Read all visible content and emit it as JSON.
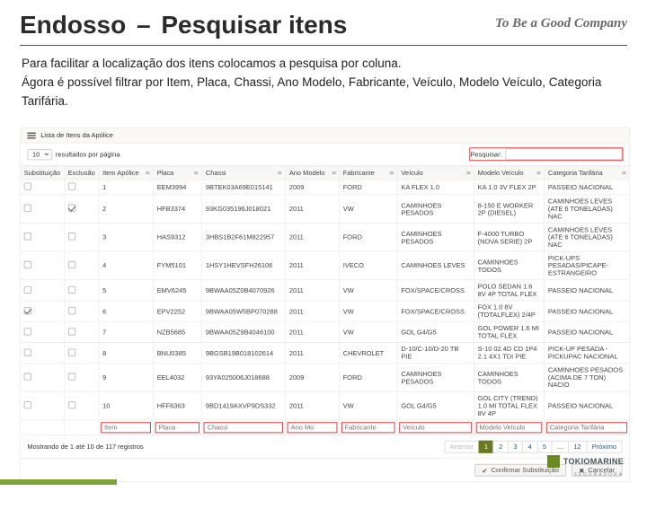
{
  "header": {
    "title_a": "Endosso",
    "dash": "–",
    "title_b": "Pesquisar itens",
    "tagline": "To Be a Good Company"
  },
  "description": {
    "line1": "Para facilitar a localização dos itens colocamos a pesquisa por coluna.",
    "line2": "Ágora é possível filtrar por Item, Placa, Chassi, Ano Modelo, Fabricante, Veículo, Modelo Veículo, Categoria Tarifária."
  },
  "panel": {
    "title": "Lista de Itens da Apólice",
    "per_page_value": "10",
    "per_page_label": "resultados por página",
    "search_label": "Pesquisar:",
    "search_placeholder": ""
  },
  "columns": [
    "Substituição",
    "Exclusão",
    "Item Apólice",
    "Placa",
    "Chassi",
    "Ano Modelo",
    "Fabricante",
    "Veículo",
    "Modelo Veículo",
    "Categoria Tarifária"
  ],
  "rows": [
    {
      "sub": false,
      "exc": false,
      "item": "1",
      "placa": "EEM3994",
      "chassi": "9BTEK03A69E015141",
      "ano": "2009",
      "fab": "FORD",
      "vei": "KA FLEX 1.0",
      "mod": "KA 1.0 3V FLEX 2P",
      "cat": "PASSEIO NACIONAL"
    },
    {
      "sub": false,
      "exc": true,
      "item": "2",
      "placa": "HFB3374",
      "chassi": "93KG035196J018021",
      "ano": "2011",
      "fab": "VW",
      "vei": "CAMINHOES PESADOS",
      "mod": "8-150 E WORKER 2P (DIESEL)",
      "cat": "CAMINHOES LEVES (ATE 6 TONELADAS) NAC"
    },
    {
      "sub": false,
      "exc": false,
      "item": "3",
      "placa": "HAS9312",
      "chassi": "3HBS1B2F61M822957",
      "ano": "2011",
      "fab": "FORD",
      "vei": "CAMINHOES PESADOS",
      "mod": "F-4000 TURBO (NOVA SERIE) 2P",
      "cat": "CAMINHOES LEVES (ATE 6 TONELADAS) NAC"
    },
    {
      "sub": false,
      "exc": false,
      "item": "4",
      "placa": "FYM5101",
      "chassi": "1HSY1HEVSFH26106",
      "ano": "2011",
      "fab": "IVECO",
      "vei": "CAMINHOES LEVES",
      "mod": "CAMINHOES TODOS",
      "cat": "PICK-UPS PESADAS/PICAPE-ESTRANGEIRO"
    },
    {
      "sub": false,
      "exc": false,
      "item": "5",
      "placa": "EMV6245",
      "chassi": "9BWAA05Z0B4070926",
      "ano": "2011",
      "fab": "VW",
      "vei": "FOX/SPACE/CROSS",
      "mod": "POLO SEDAN 1.6 8V 4P TOTAL FLEX",
      "cat": "PASSEIO NACIONAL"
    },
    {
      "sub": true,
      "exc": false,
      "item": "6",
      "placa": "EPV2252",
      "chassi": "9BWAA05W5BP070288",
      "ano": "2011",
      "fab": "VW",
      "vei": "FOX/SPACE/CROSS",
      "mod": "FOX 1.0 8V (TOTALFLEX) 2/4P",
      "cat": "PASSEIO NACIONAL"
    },
    {
      "sub": false,
      "exc": false,
      "item": "7",
      "placa": "NZB5685",
      "chassi": "9BWAA05Z9B4046100",
      "ano": "2011",
      "fab": "VW",
      "vei": "GOL G4/G5",
      "mod": "GOL POWER 1.6 MI TOTAL FLEX",
      "cat": "PASSEIO NACIONAL"
    },
    {
      "sub": false,
      "exc": false,
      "item": "8",
      "placa": "BNU0385",
      "chassi": "9BGSB19B018102614",
      "ano": "2011",
      "fab": "CHEVROLET",
      "vei": "D-10/C-10/D-20 TB PIE",
      "mod": "S-10 02.4D CD 1P4 2.1 4X1 TDI PIE",
      "cat": "PICK-UP PESADA - PICKUPAC NACIONAL"
    },
    {
      "sub": false,
      "exc": false,
      "item": "9",
      "placa": "EEL4032",
      "chassi": "93YA025006J018688",
      "ano": "2009",
      "fab": "FORD",
      "vei": "CAMINHOES PESADOS",
      "mod": "CAMINHOES TODOS",
      "cat": "CAMINHOES PESADOS (ACIMA DE 7 TON) NACIO"
    },
    {
      "sub": false,
      "exc": false,
      "item": "10",
      "placa": "HFF6363",
      "chassi": "9BD1419AXVP9DS332",
      "ano": "2011",
      "fab": "VW",
      "vei": "GOL G4/G5",
      "mod": "GOL CITY (TREND) 1.0 MI TOTAL FLEX 8V 4P",
      "cat": "PASSEIO NACIONAL"
    }
  ],
  "filter_placeholders": [
    "Item",
    "Placa",
    "Chassi",
    "Ano Mo",
    "Fabricante",
    "Veículo",
    "Modelo Veículo",
    "Categoria Tarifária"
  ],
  "footer": {
    "info": "Mostrando de 1 até 10 de 117 registros",
    "pager": {
      "prev": "Anterior",
      "pages": [
        "1",
        "2",
        "3",
        "4",
        "5",
        "...",
        "12"
      ],
      "next": "Próximo",
      "active": 0
    }
  },
  "actions": {
    "confirm": "Confirmar Substituição",
    "cancel": "Cancelar"
  },
  "brand": {
    "name": "TOKIOMARINE",
    "sub": "SEGURADORA"
  }
}
